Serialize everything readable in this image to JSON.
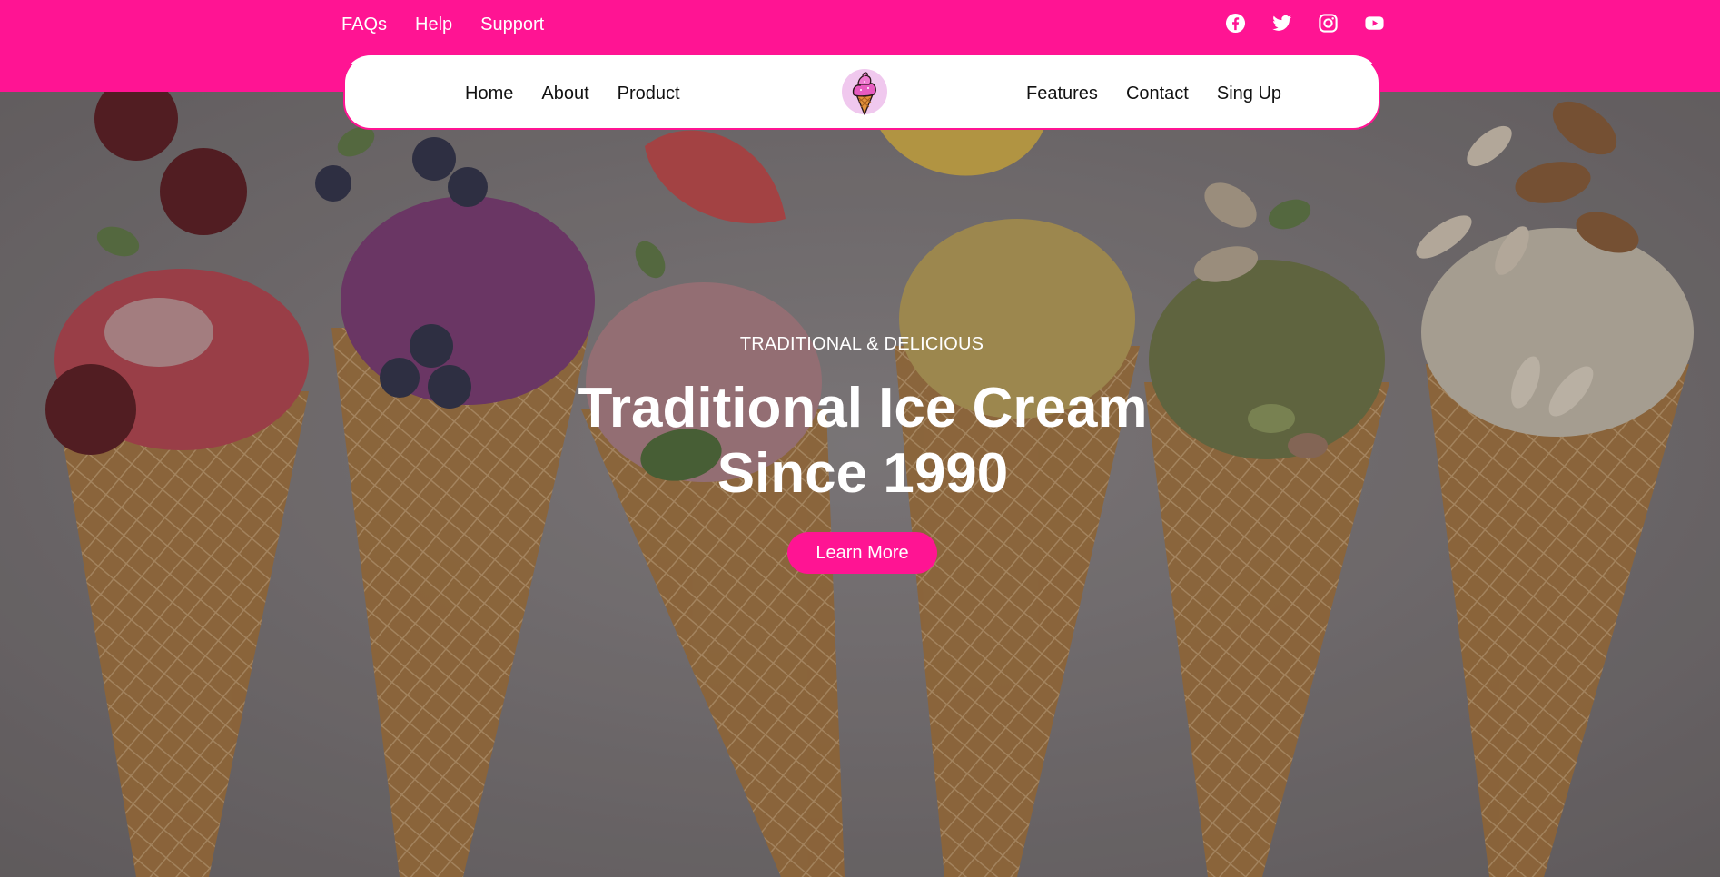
{
  "topbar": {
    "links": [
      "FAQs",
      "Help",
      "Support"
    ],
    "socials": [
      "facebook-icon",
      "twitter-icon",
      "instagram-icon",
      "youtube-icon"
    ]
  },
  "nav": {
    "left": [
      "Home",
      "About",
      "Product"
    ],
    "right": [
      "Features",
      "Contact",
      "Sing Up"
    ],
    "logo": "ice-cream-logo-icon"
  },
  "hero": {
    "eyebrow": "TRADITIONAL & DELICIOUS",
    "title_line1": "Traditional Ice Cream",
    "title_line2": "Since 1990",
    "cta": "Learn More"
  },
  "colors": {
    "brand": "#ff1493",
    "nav_bg": "#ffffff",
    "text_dark": "#111111",
    "text_light": "#ffffff"
  }
}
